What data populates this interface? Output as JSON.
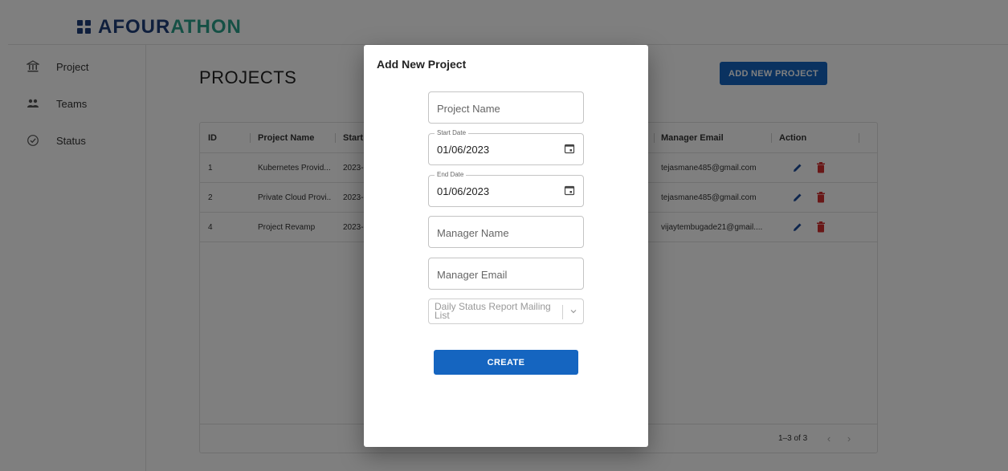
{
  "app": {
    "logo_prefix": "AFOUR",
    "logo_suffix": "ATHON"
  },
  "sidebar": {
    "items": [
      {
        "label": "Project",
        "icon": "bank-icon"
      },
      {
        "label": "Teams",
        "icon": "people-icon"
      },
      {
        "label": "Status",
        "icon": "check-circle-icon"
      }
    ]
  },
  "main": {
    "title": "PROJECTS",
    "add_button": "ADD NEW PROJECT"
  },
  "table": {
    "columns": [
      "ID",
      "Project Name",
      "Start",
      "Manager Email",
      "Action"
    ],
    "rows": [
      {
        "id": "1",
        "name": "Kubernetes Provid...",
        "start": "2023-",
        "email": "tejasmane485@gmail.com"
      },
      {
        "id": "2",
        "name": "Private Cloud Provi...",
        "start": "2023-",
        "email": "tejasmane485@gmail.com"
      },
      {
        "id": "4",
        "name": "Project Revamp",
        "start": "2023-",
        "email": "vijaytembugade21@gmail...."
      }
    ],
    "pagination": "1–3 of 3"
  },
  "modal": {
    "title": "Add New Project",
    "project_name_placeholder": "Project Name",
    "start_date_label": "Start Date",
    "start_date_value": "01/06/2023",
    "end_date_label": "End Date",
    "end_date_value": "01/06/2023",
    "manager_name_placeholder": "Manager Name",
    "manager_email_placeholder": "Manager Email",
    "mailing_list_placeholder": "Daily Status Report Mailing List",
    "create_button": "CREATE"
  },
  "colors": {
    "primary": "#1565c0",
    "delete": "#d32f2f",
    "logo_blue": "#1f3f7a",
    "logo_teal": "#2aa08a",
    "backdrop": "rgba(0,0,0,0.5)"
  }
}
